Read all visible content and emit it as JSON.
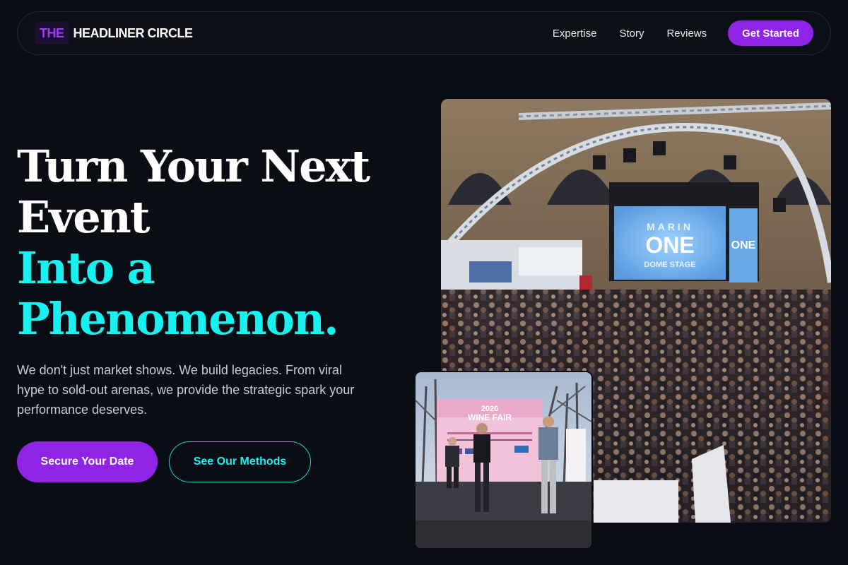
{
  "nav": {
    "logo_mark": "THE",
    "logo_text": "HEADLINER CIRCLE",
    "links": [
      "Expertise",
      "Story",
      "Reviews"
    ],
    "cta": "Get Started"
  },
  "hero": {
    "title_line1": "Turn Your Next",
    "title_line2": "Event",
    "title_line3": "Into a",
    "title_line4": "Phenomenon.",
    "description": "We don't just market shows. We build legacies. From viral hype to sold-out arenas, we provide the strategic spark your performance deserves.",
    "primary_button": "Secure Your Date",
    "secondary_button": "See Our Methods"
  },
  "images": {
    "main": {
      "screen_line1": "MARIN",
      "screen_line2": "ONE",
      "screen_line3": "DOME STAGE",
      "side_screen": "ONE"
    },
    "small": {
      "banner_year": "2026",
      "banner_title": "WINE FAIR"
    }
  },
  "colors": {
    "background": "#0b0d14",
    "accent_purple": "#8f24e6",
    "accent_cyan": "#19f0f0"
  }
}
